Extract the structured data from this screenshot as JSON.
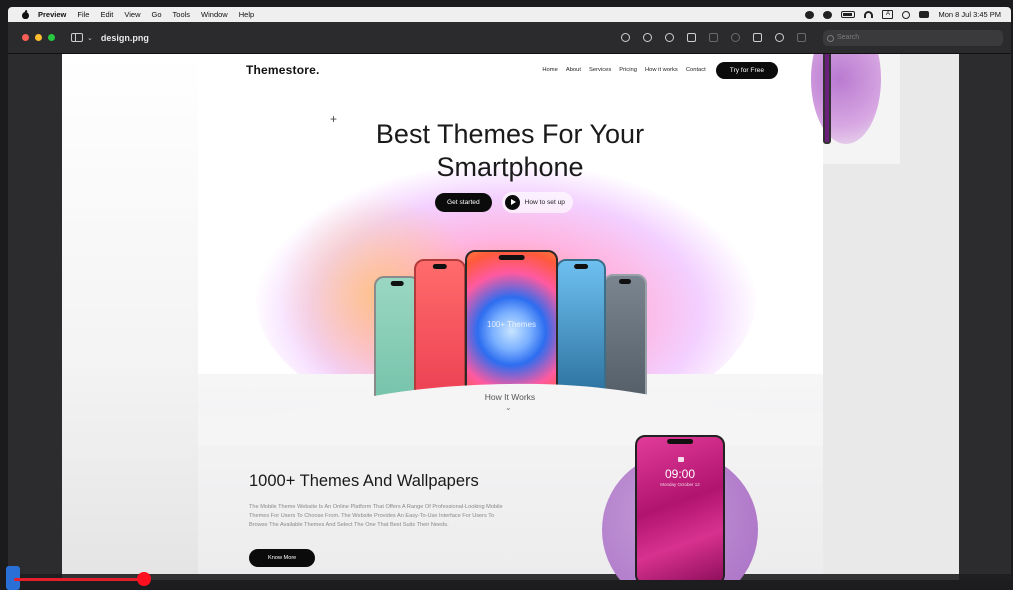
{
  "menubar": {
    "app_name": "Preview",
    "items": [
      "File",
      "Edit",
      "View",
      "Go",
      "Tools",
      "Window",
      "Help"
    ],
    "input_badge": "A",
    "clock": "Mon 8 Jul  3:45 PM"
  },
  "window": {
    "title": "design.png",
    "search_placeholder": "Search"
  },
  "design": {
    "logo": "Themestore.",
    "nav_links": [
      "Home",
      "About",
      "Services",
      "Pricing",
      "How it works",
      "Contact"
    ],
    "cta": "Try for Free",
    "hero_line1": "Best Themes For Your",
    "hero_line2": "Smartphone",
    "get_started": "Get started",
    "how_to": "How to set up",
    "phone_label": "100+ Themes",
    "how_it_works": "How It Works",
    "section_title": "1000+ Themes And Wallpapers",
    "section_body": "The Mobile Theme Website Is An Online Platform That Offers A Range Of Professional-Looking Mobile Themes For Users To Choose From. The Website Provides An Easy-To-Use Interface For Users To Browse The Available Themes And Select The One That Best Suits Their Needs.",
    "know_more": "Know More",
    "lock_time": "09:00",
    "lock_date": "Monday October 12"
  },
  "player": {
    "progress": 0.13
  },
  "colors": {
    "accent": "#0b0b0b",
    "progress": "#e41e2b",
    "menubar_bg": "#efefef",
    "titlebar_bg": "#2b2b2d"
  }
}
